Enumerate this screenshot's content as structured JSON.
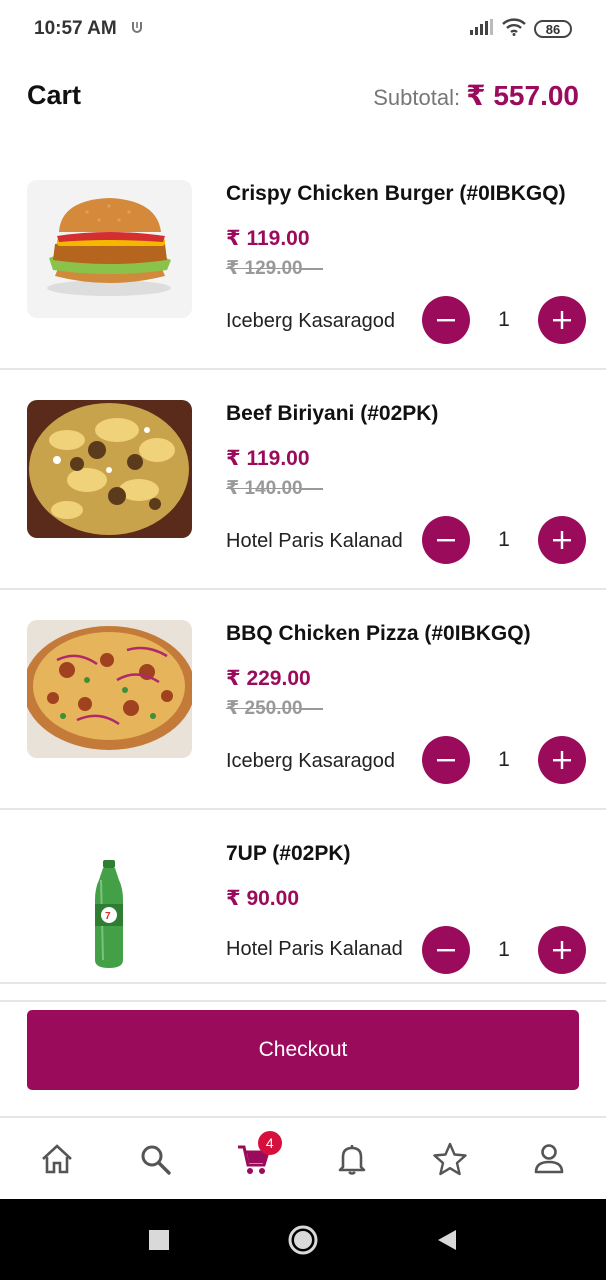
{
  "status_bar": {
    "time": "10:57 AM",
    "extra_icon": "u-shield-icon",
    "battery": "86"
  },
  "header": {
    "title": "Cart",
    "subtotal_label": "Subtotal:",
    "subtotal_value": "₹ 557.00"
  },
  "items": [
    {
      "name": "Crispy Chicken Burger (#0IBKGQ)",
      "price": "₹ 119.00",
      "original_price": "₹ 129.00",
      "store": "Iceberg Kasaragod",
      "quantity": "1",
      "image": "burger"
    },
    {
      "name": "Beef Biriyani (#02PK)",
      "price": "₹ 119.00",
      "original_price": "₹ 140.00",
      "store": "Hotel Paris Kalanad",
      "quantity": "1",
      "image": "biriyani"
    },
    {
      "name": "BBQ Chicken Pizza (#0IBKGQ)",
      "price": "₹ 229.00",
      "original_price": "₹ 250.00",
      "store": "Iceberg Kasaragod",
      "quantity": "1",
      "image": "pizza"
    },
    {
      "name": "7UP (#02PK)",
      "price": "₹ 90.00",
      "store": "Hotel Paris Kalanad",
      "quantity": "1",
      "image": "soda-bottle"
    }
  ],
  "checkout": {
    "label": "Checkout"
  },
  "bottom_nav": {
    "items": [
      "home-icon",
      "search-icon",
      "cart-icon",
      "bell-icon",
      "star-icon",
      "user-icon"
    ],
    "cart_badge": "4",
    "active": "cart-icon"
  },
  "colors": {
    "accent": "#9b0b5c",
    "badge": "#d6103c",
    "strike": "#999999"
  }
}
